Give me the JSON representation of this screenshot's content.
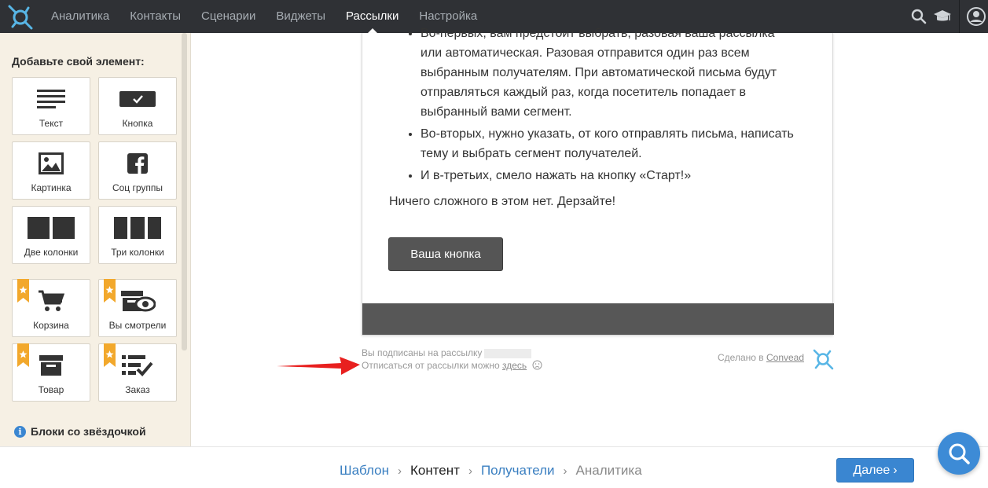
{
  "nav": {
    "items": [
      "Аналитика",
      "Контакты",
      "Сценарии",
      "Виджеты",
      "Рассылки",
      "Настройка"
    ],
    "active_index": 4
  },
  "sidebar": {
    "title": "Добавьте свой элемент:",
    "tiles": [
      {
        "label": "Текст",
        "icon": "text-lines-icon",
        "premium": false
      },
      {
        "label": "Кнопка",
        "icon": "button-check-icon",
        "premium": false
      },
      {
        "label": "Картинка",
        "icon": "image-icon",
        "premium": false
      },
      {
        "label": "Соц группы",
        "icon": "facebook-icon",
        "premium": false
      },
      {
        "label": "Две колонки",
        "icon": "two-columns-icon",
        "premium": false
      },
      {
        "label": "Три колонки",
        "icon": "three-columns-icon",
        "premium": false
      },
      {
        "label": "Корзина",
        "icon": "cart-icon",
        "premium": true
      },
      {
        "label": "Вы смотрели",
        "icon": "box-eye-icon",
        "premium": true
      },
      {
        "label": "Товар",
        "icon": "product-box-icon",
        "premium": true
      },
      {
        "label": "Заказ",
        "icon": "order-list-icon",
        "premium": true
      }
    ],
    "footer": "Блоки со звёздочкой"
  },
  "email": {
    "bullets": [
      "Во-первых, вам предстоит выбрать, разовая ваша рассылка или автоматическая. Разовая отправится один раз всем выбранным получателям. При автоматической письма будут отправляться каждый раз, когда посетитель попадает в выбранный вами сегмент.",
      "Во-вторых, нужно указать, от кого отправлять письма, написать тему и выбрать сегмент получателей.",
      "И в-третьих, смело нажать на кнопку «Старт!»"
    ],
    "closing": "Ничего сложного в этом нет. Дерзайте!",
    "button_label": "Ваша кнопка"
  },
  "footer_notice": {
    "subscribed": "Вы подписаны на рассылку",
    "unsubscribe_prefix": "Отписаться от рассылки можно",
    "unsubscribe_link": "здесь",
    "made_in_prefix": "Сделано в",
    "made_in_link": "Convead"
  },
  "wizard": {
    "steps": [
      "Шаблон",
      "Контент",
      "Получатели",
      "Аналитика"
    ],
    "current_index": 1,
    "next_label": "Далее"
  },
  "colors": {
    "nav_bg": "#2f3135",
    "sidebar_bg": "#f6f0e4",
    "accent": "#3a86d1",
    "premium_ribbon": "#f2a82c",
    "email_button": "#555555",
    "arrow": "#e8201f"
  }
}
